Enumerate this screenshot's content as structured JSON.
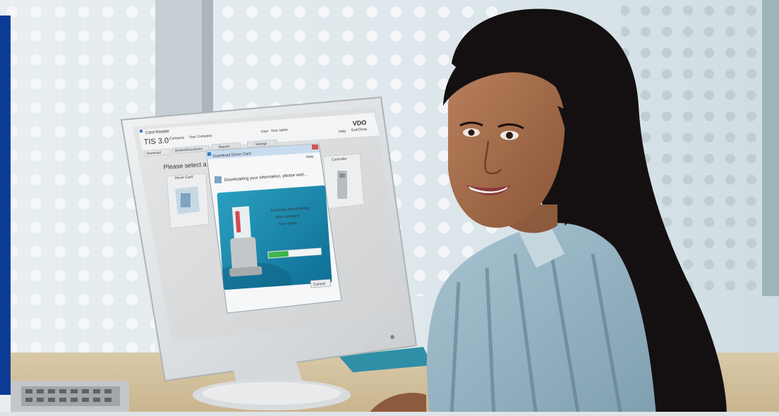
{
  "photo": {
    "subject": "woman-at-computer",
    "accent_bar_color": "#0b3b95"
  },
  "screen": {
    "app_window_title": "Card Reader",
    "app_name": "TIS 3.0",
    "brand": "VDO",
    "company_label": "Company",
    "company_value": "Your Company",
    "user_label": "User",
    "user_value": "Your name",
    "header_link_help": "Help",
    "header_link_exit": "Exit/Close",
    "tabs": [
      "Download",
      "Archive/Documents",
      "Reports",
      "Settings"
    ],
    "panel_heading": "Please select a file",
    "left_card_title": "Driver Card",
    "right_card_title": "Controller",
    "dialog": {
      "title": "Download Driver Card",
      "help": "Help",
      "message": "Downloading your information, please wait...",
      "graphic_text_line1": "Currently downloading",
      "graphic_text_line2": "Your company",
      "graphic_text_line3": "Your driver",
      "progress": 0.38,
      "cancel_label": "Cancel"
    }
  }
}
